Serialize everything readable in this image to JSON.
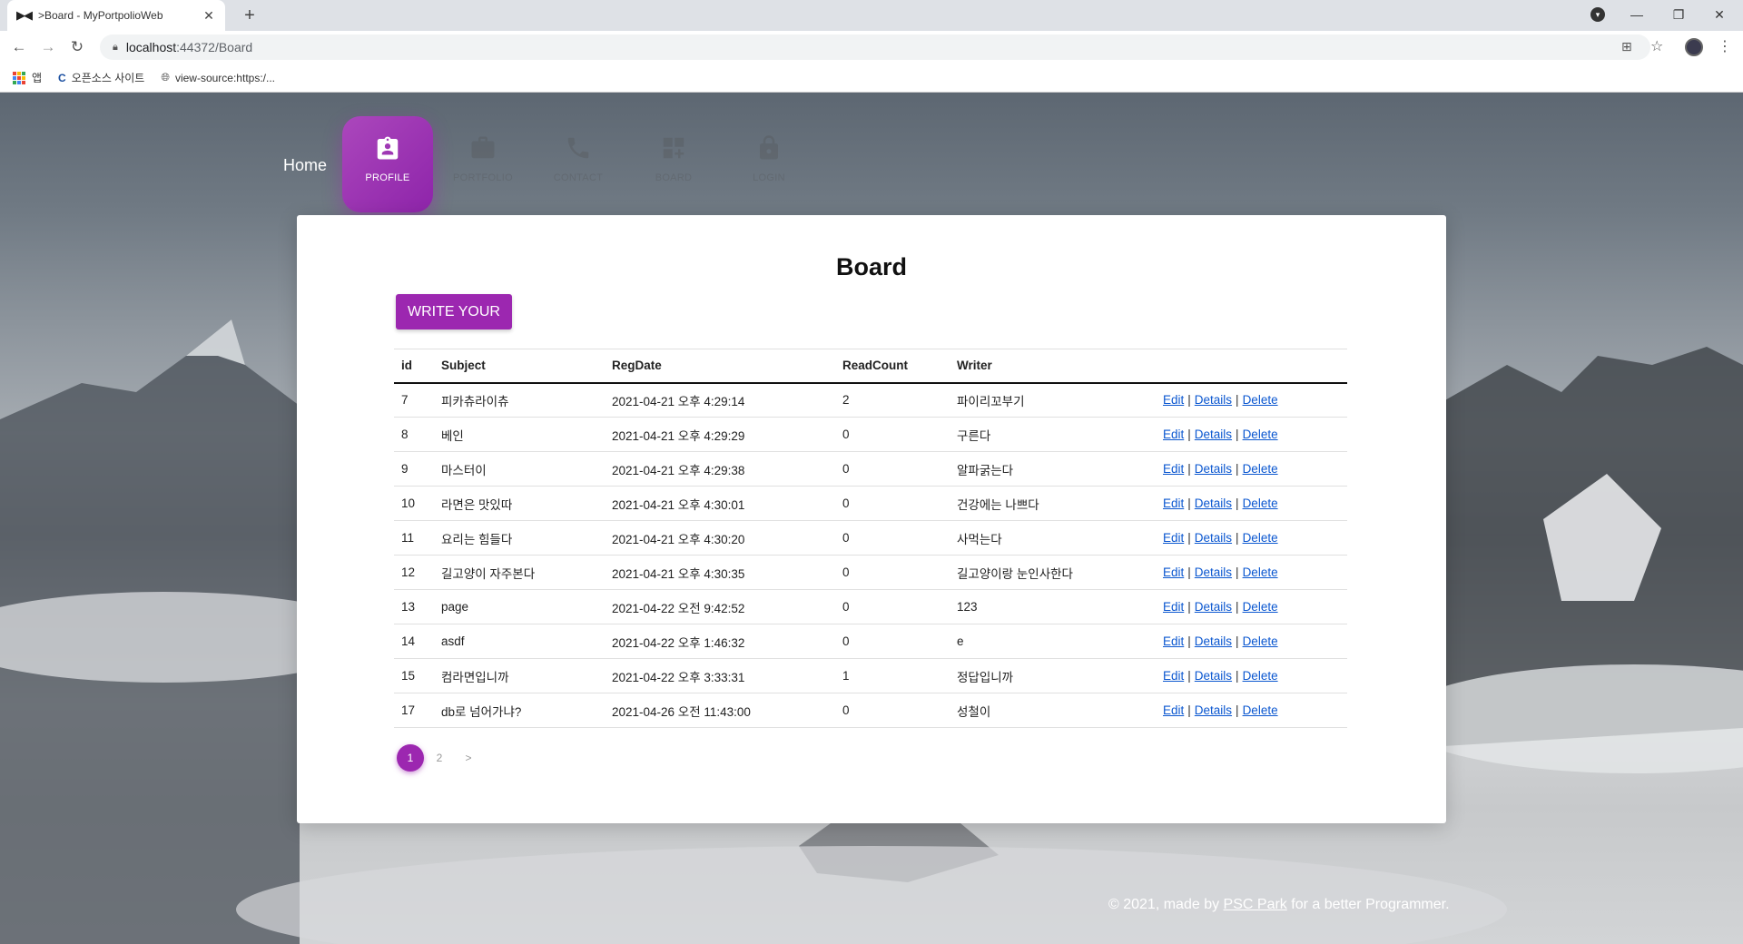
{
  "browser": {
    "tab_title": ">Board - MyPortpolioWeb",
    "url_host": "localhost",
    "url_port_path": ":44372/Board",
    "bookmarks": [
      "앱",
      "오픈소스 사이트",
      "view-source:https:/..."
    ]
  },
  "nav": {
    "home": "Home",
    "items": [
      {
        "label": "PROFILE",
        "icon": "badge-icon",
        "active": true
      },
      {
        "label": "PORTFOLIO",
        "icon": "briefcase-icon",
        "active": false
      },
      {
        "label": "CONTACT",
        "icon": "phone-icon",
        "active": false
      },
      {
        "label": "BOARD",
        "icon": "dashboard-icon",
        "active": false
      },
      {
        "label": "LOGIN",
        "icon": "lock-icon",
        "active": false
      }
    ]
  },
  "board": {
    "title": "Board",
    "write_button": "WRITE YOUR",
    "columns": [
      "id",
      "Subject",
      "RegDate",
      "ReadCount",
      "Writer"
    ],
    "actions": [
      "Edit",
      "Details",
      "Delete"
    ],
    "rows": [
      {
        "id": "7",
        "subject": "피카츄라이츄",
        "regdate": "2021-04-21 오후 4:29:14",
        "readcount": "2",
        "writer": "파이리꼬부기"
      },
      {
        "id": "8",
        "subject": "베인",
        "regdate": "2021-04-21 오후 4:29:29",
        "readcount": "0",
        "writer": "구른다"
      },
      {
        "id": "9",
        "subject": "마스터이",
        "regdate": "2021-04-21 오후 4:29:38",
        "readcount": "0",
        "writer": "알파굵는다"
      },
      {
        "id": "10",
        "subject": "라면은 맛있따",
        "regdate": "2021-04-21 오후 4:30:01",
        "readcount": "0",
        "writer": "건강에는 나쁘다"
      },
      {
        "id": "11",
        "subject": "요리는 힘들다",
        "regdate": "2021-04-21 오후 4:30:20",
        "readcount": "0",
        "writer": "사먹는다"
      },
      {
        "id": "12",
        "subject": "길고양이 자주본다",
        "regdate": "2021-04-21 오후 4:30:35",
        "readcount": "0",
        "writer": "길고양이랑 눈인사한다"
      },
      {
        "id": "13",
        "subject": "page",
        "regdate": "2021-04-22 오전 9:42:52",
        "readcount": "0",
        "writer": "123"
      },
      {
        "id": "14",
        "subject": "asdf",
        "regdate": "2021-04-22 오후 1:46:32",
        "readcount": "0",
        "writer": "e"
      },
      {
        "id": "15",
        "subject": "컴라면입니까",
        "regdate": "2021-04-22 오후 3:33:31",
        "readcount": "1",
        "writer": "정답입니까"
      },
      {
        "id": "17",
        "subject": "db로 넘어가냐?",
        "regdate": "2021-04-26 오전 11:43:00",
        "readcount": "0",
        "writer": "성철이"
      }
    ],
    "pagination": {
      "pages": [
        "1",
        "2"
      ],
      "next": ">",
      "current": "1"
    }
  },
  "footer": {
    "prefix": "© 2021, made by",
    "author": "PSC Park",
    "suffix": "for a better Programmer."
  },
  "colors": {
    "accent": "#9c27b0",
    "link": "#0b57d0"
  }
}
